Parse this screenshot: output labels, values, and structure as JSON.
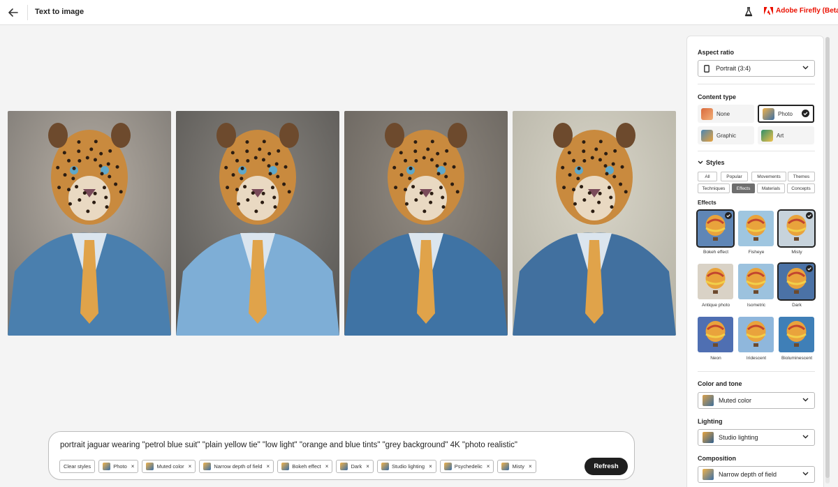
{
  "header": {
    "title": "Text to image",
    "brand": "Adobe Firefly (Beta)",
    "colors": {
      "brand": "#eb1000"
    }
  },
  "images": [
    {
      "alt": "jaguar-portrait-1"
    },
    {
      "alt": "jaguar-portrait-2"
    },
    {
      "alt": "jaguar-portrait-3"
    },
    {
      "alt": "jaguar-portrait-4"
    }
  ],
  "prompt": {
    "text": "portrait jaguar wearing \"petrol blue suit\"  \"plain yellow tie\" \"low light\" \"orange and blue tints\" \"grey background\" 4K \"photo realistic\"",
    "clear_label": "Clear styles",
    "chips": [
      "Photo",
      "Muted color",
      "Narrow depth of field",
      "Bokeh effect",
      "Dark",
      "Studio lighting",
      "Psychedelic",
      "Misty"
    ],
    "refresh_label": "Refresh"
  },
  "panel": {
    "aspect_ratio": {
      "label": "Aspect ratio",
      "value": "Portrait (3:4)"
    },
    "content_type": {
      "label": "Content type",
      "options": [
        "None",
        "Photo",
        "Graphic",
        "Art"
      ],
      "selected": "Photo"
    },
    "styles": {
      "label": "Styles",
      "tabs": [
        "All",
        "Popular",
        "Movements",
        "Themes",
        "Techniques",
        "Effects",
        "Materials",
        "Concepts"
      ],
      "active_tab": "Effects",
      "effects_label": "Effects",
      "effects": [
        {
          "name": "Bokeh effect",
          "selected": true
        },
        {
          "name": "Fisheye",
          "selected": false
        },
        {
          "name": "Misty",
          "selected": true
        },
        {
          "name": "Antique photo",
          "selected": false
        },
        {
          "name": "Isometric",
          "selected": false
        },
        {
          "name": "Dark",
          "selected": true
        },
        {
          "name": "Neon",
          "selected": false
        },
        {
          "name": "Iridescent",
          "selected": false
        },
        {
          "name": "Bioluminescent",
          "selected": false
        }
      ]
    },
    "color_tone": {
      "label": "Color and tone",
      "value": "Muted color"
    },
    "lighting": {
      "label": "Lighting",
      "value": "Studio lighting"
    },
    "composition": {
      "label": "Composition",
      "value": "Narrow depth of field"
    }
  }
}
